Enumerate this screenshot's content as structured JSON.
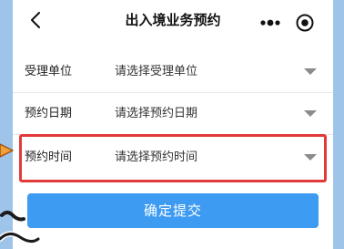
{
  "nav": {
    "title": "出入境业务预约",
    "back_icon": "chevron-left-icon",
    "more_icon": "more-dots-icon",
    "target_icon": "target-icon"
  },
  "form": {
    "rows": [
      {
        "label": "受理单位",
        "value": "请选择受理单位"
      },
      {
        "label": "预约日期",
        "value": "请选择预约日期"
      },
      {
        "label": "预约时间",
        "value": "请选择预约时间"
      }
    ]
  },
  "submit_label": "确定提交",
  "colors": {
    "accent": "#3d9bf2",
    "highlight": "#e23a3a",
    "backdrop": "#9fc4ea"
  }
}
